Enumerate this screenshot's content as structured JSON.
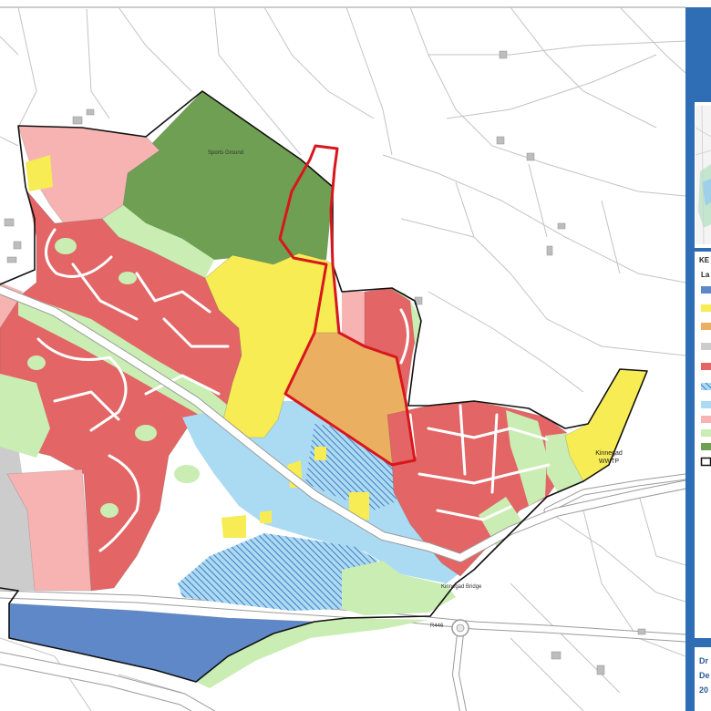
{
  "map": {
    "labels": {
      "sports_ground": "Sports Ground",
      "wwtp_name": "Kinnegad",
      "wwtp_type": "WWTP",
      "bridge": "Kinnegad Bridge",
      "road": "R446"
    }
  },
  "zone_colors": {
    "residential": "#e36565",
    "residential_pink": "#f6b3b2",
    "yellow": "#f7ec53",
    "orange": "#ebaf62",
    "dark_green": "#6e9f52",
    "light_green": "#c9edb2",
    "light_blue": "#aadbf2",
    "dark_blue": "#5f88c8",
    "gray": "#cccccc",
    "boundary_red": "#d9161d",
    "frame_blue": "#2f6db5"
  },
  "key": {
    "heading": "KE",
    "subheading": "La",
    "swatches": [
      "#5f88c8",
      "#f7ec53",
      "#ebaf62",
      "#cccccc",
      "#e36565",
      "#aadbf2",
      "#f6b3b2",
      "#c9edb2",
      "#6e9f52"
    ]
  },
  "footer": {
    "line1": "Dr",
    "line2": "De",
    "line3": "20"
  }
}
